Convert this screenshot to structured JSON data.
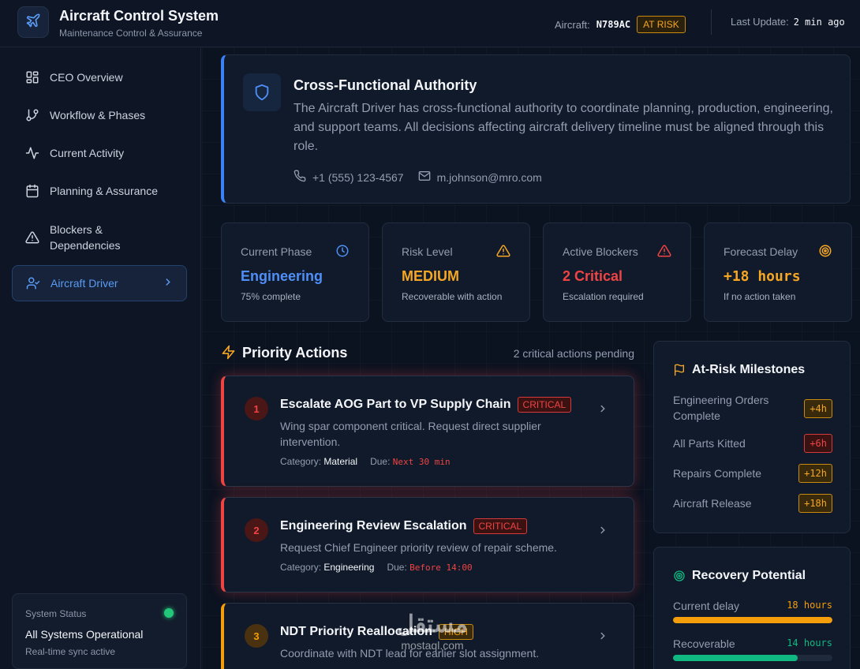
{
  "header": {
    "title": "Aircraft Control System",
    "subtitle": "Maintenance Control & Assurance",
    "aircraft_label": "Aircraft:",
    "aircraft_tail": "N789AC",
    "status_badge": "AT RISK",
    "update_label": "Last Update:",
    "update_value": "2 min ago"
  },
  "sidebar": {
    "items": [
      {
        "label": "CEO Overview",
        "icon": "grid-icon"
      },
      {
        "label": "Workflow & Phases",
        "icon": "branch-icon"
      },
      {
        "label": "Current Activity",
        "icon": "activity-icon"
      },
      {
        "label": "Planning & Assurance",
        "icon": "calendar-icon"
      },
      {
        "label": "Blockers & Dependencies",
        "icon": "warning-icon"
      },
      {
        "label": "Aircraft Driver",
        "icon": "user-check-icon",
        "active": true
      }
    ],
    "status": {
      "label": "System Status",
      "title": "All Systems Operational",
      "sub": "Real-time sync active",
      "color": "#22c77a"
    }
  },
  "authority": {
    "title": "Cross-Functional Authority",
    "text": "The Aircraft Driver has cross-functional authority to coordinate planning, production, engineering, and support teams. All decisions affecting aircraft delivery timeline must be aligned through this role.",
    "phone": "+1 (555) 123-4567",
    "email": "m.johnson@mro.com"
  },
  "kpis": [
    {
      "label": "Current Phase",
      "value": "Engineering",
      "sub": "75% complete",
      "color": "#4f8ff7",
      "icon": "clock-icon"
    },
    {
      "label": "Risk Level",
      "value": "MEDIUM",
      "sub": "Recoverable with action",
      "color": "#f5a623",
      "icon": "warning-icon"
    },
    {
      "label": "Active Blockers",
      "value": "2 Critical",
      "sub": "Escalation required",
      "color": "#ef4444",
      "icon": "alert-icon"
    },
    {
      "label": "Forecast Delay",
      "value": "+18 hours",
      "sub": "If no action taken",
      "color": "#f5a623",
      "icon": "target-icon"
    }
  ],
  "priority_actions": {
    "title": "Priority Actions",
    "count": "2 critical actions pending",
    "category_label": "Category:",
    "due_label": "Due:",
    "items": [
      {
        "num": "1",
        "title": "Escalate AOG Part to VP Supply Chain",
        "severity": "CRITICAL",
        "desc": "Wing spar component critical. Request direct supplier intervention.",
        "category": "Material",
        "due": "Next 30 min"
      },
      {
        "num": "2",
        "title": "Engineering Review Escalation",
        "severity": "CRITICAL",
        "desc": "Request Chief Engineer priority review of repair scheme.",
        "category": "Engineering",
        "due": "Before 14:00"
      },
      {
        "num": "3",
        "title": "NDT Priority Reallocation",
        "severity": "HIGH",
        "desc": "Coordinate with NDT lead for earlier slot assignment.",
        "category": "",
        "due": ""
      }
    ]
  },
  "milestones": {
    "title": "At-Risk Milestones",
    "items": [
      {
        "label": "Engineering Orders Complete",
        "delay": "+4h",
        "tone": "amber"
      },
      {
        "label": "All Parts Kitted",
        "delay": "+6h",
        "tone": "red"
      },
      {
        "label": "Repairs Complete",
        "delay": "+12h",
        "tone": "amber"
      },
      {
        "label": "Aircraft Release",
        "delay": "+18h",
        "tone": "amber"
      }
    ]
  },
  "recovery": {
    "title": "Recovery Potential",
    "rows": [
      {
        "label": "Current delay",
        "value": "18 hours",
        "fraction": 1.0,
        "color": "#f59e0b"
      },
      {
        "label": "Recoverable",
        "value": "14 hours",
        "fraction": 0.78,
        "color": "#10b981"
      }
    ]
  },
  "watermark": {
    "arabic": "مستقل",
    "latin": "mostaql.com"
  }
}
